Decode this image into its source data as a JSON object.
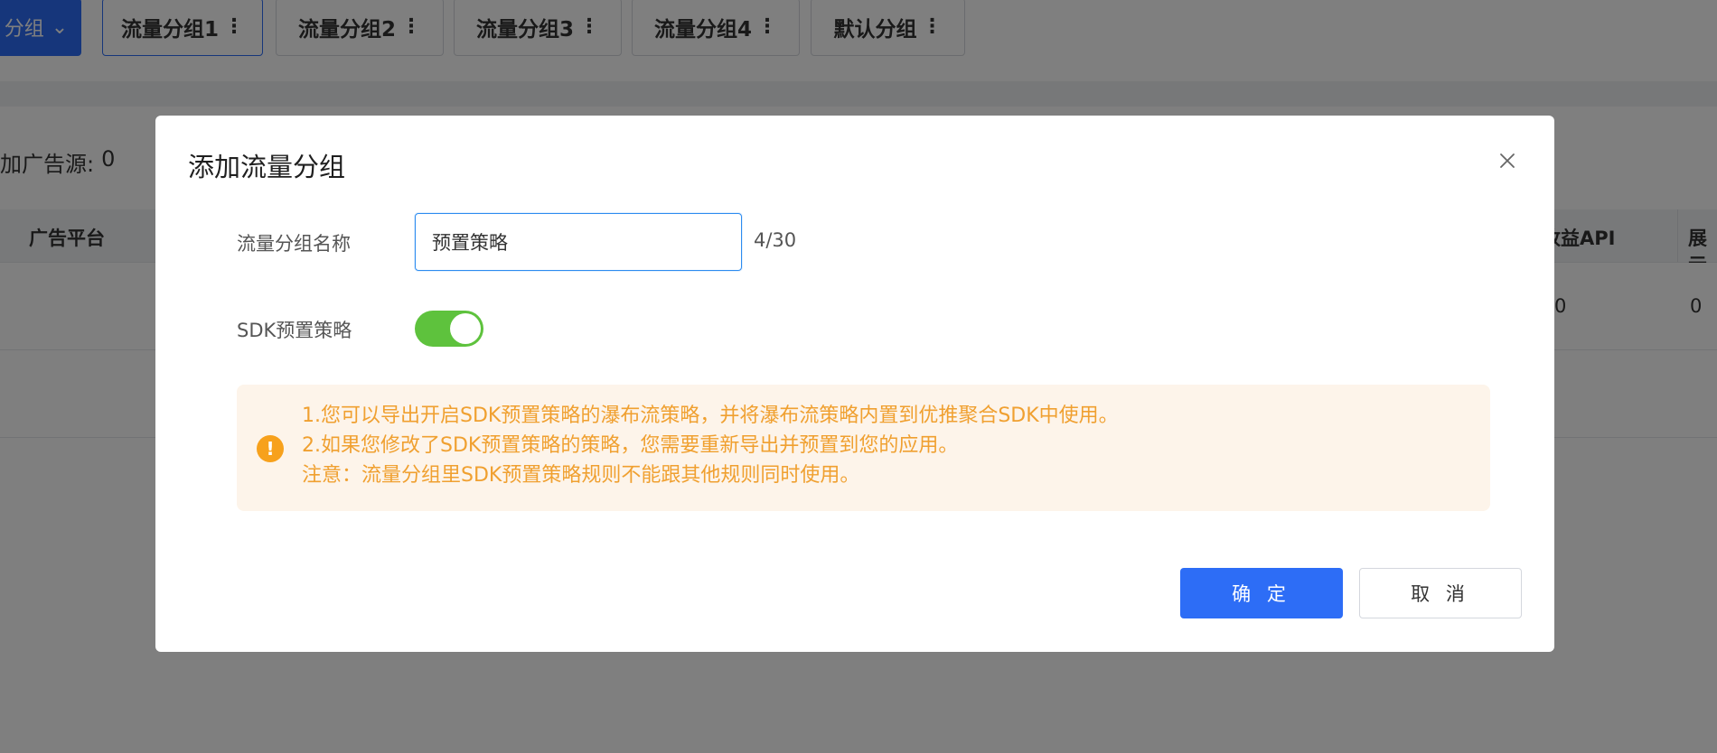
{
  "background": {
    "primary_tab_label": "分组",
    "tabs": [
      {
        "label": "流量分组1"
      },
      {
        "label": "流量分组2"
      },
      {
        "label": "流量分组3"
      },
      {
        "label": "流量分组4"
      },
      {
        "label": "默认分组"
      }
    ],
    "ad_source_label": "加广告源:",
    "ad_source_count": "0",
    "table": {
      "headers": [
        "广告平台",
        "收益API",
        "展示"
      ],
      "row_values": [
        "0",
        "0"
      ]
    }
  },
  "modal": {
    "title": "添加流量分组",
    "name_label": "流量分组名称",
    "name_value": "预置策略",
    "name_counter": "4/30",
    "sdk_label": "SDK预置策略",
    "sdk_enabled": true,
    "notice": {
      "lines": [
        "1.您可以导出开启SDK预置策略的瀑布流策略，并将瀑布流策略内置到优推聚合SDK中使用。",
        "2.如果您修改了SDK预置策略的策略，您需要重新导出并预置到您的应用。",
        "注意：流量分组里SDK预置策略规则不能跟其他规则同时使用。"
      ]
    },
    "confirm_label": "确 定",
    "cancel_label": "取 消"
  }
}
